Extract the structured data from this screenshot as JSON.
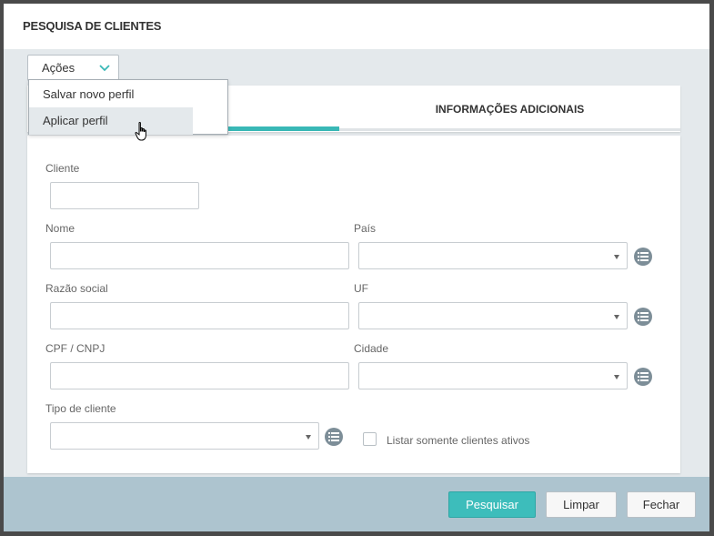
{
  "dialog": {
    "title": "PESQUISA DE CLIENTES"
  },
  "actions": {
    "label": "Ações",
    "menu": [
      {
        "label": "Salvar novo perfil"
      },
      {
        "label": "Aplicar perfil"
      }
    ]
  },
  "tabs": {
    "info_label": "INFORMAÇÕES ADICIONAIS"
  },
  "form": {
    "cliente_label": "Cliente",
    "nome_label": "Nome",
    "pais_label": "País",
    "razao_label": "Razão social",
    "uf_label": "UF",
    "cpf_label": "CPF / CNPJ",
    "cidade_label": "Cidade",
    "tipo_label": "Tipo de cliente",
    "ativos_label": "Listar somente clientes ativos"
  },
  "footer": {
    "search_label": "Pesquisar",
    "clear_label": "Limpar",
    "close_label": "Fechar"
  },
  "colors": {
    "accent": "#3dbdbb",
    "footer_bg": "#adc4cf",
    "icon_bg": "#7d8e98"
  }
}
